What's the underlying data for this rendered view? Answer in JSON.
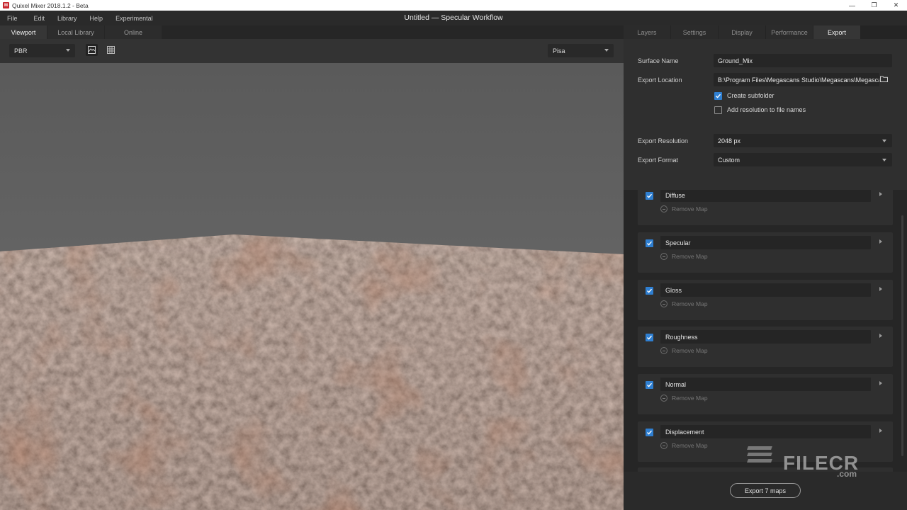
{
  "titlebar": {
    "title": "Quixel Mixer 2018.1.2 - Beta",
    "icon": "mixer-app-icon",
    "minimize": "—",
    "restore": "❐",
    "close": "✕"
  },
  "menu": {
    "items": [
      "File",
      "Edit",
      "Library",
      "Help",
      "Experimental"
    ],
    "window_title": "Untitled — Specular Workflow"
  },
  "left_tabs": [
    {
      "label": "Viewport",
      "active": true
    },
    {
      "label": "Local Library",
      "active": false
    },
    {
      "label": "Online",
      "active": false
    }
  ],
  "viewport_toolbar": {
    "render_mode": "PBR",
    "environment": "Pisa",
    "icons": [
      "image-icon",
      "grid-icon"
    ]
  },
  "right_tabs": [
    {
      "label": "Layers",
      "active": false
    },
    {
      "label": "Settings",
      "active": false
    },
    {
      "label": "Display",
      "active": false
    },
    {
      "label": "Performance",
      "active": false
    },
    {
      "label": "Export",
      "active": true
    }
  ],
  "export": {
    "surface_name_label": "Surface Name",
    "surface_name_value": "Ground_Mix",
    "export_location_label": "Export Location",
    "export_location_value": "B:\\Program Files\\Megascans Studio\\Megascans\\Megascans",
    "create_subfolder_label": "Create subfolder",
    "create_subfolder_checked": true,
    "add_resolution_label": "Add resolution to file names",
    "add_resolution_checked": false,
    "resolution_label": "Export Resolution",
    "resolution_value": "2048 px",
    "format_label": "Export Format",
    "format_value": "Custom"
  },
  "maps": [
    {
      "name": "Diffuse",
      "checked": true,
      "remove_label": "Remove Map"
    },
    {
      "name": "Specular",
      "checked": true,
      "remove_label": "Remove Map"
    },
    {
      "name": "Gloss",
      "checked": true,
      "remove_label": "Remove Map"
    },
    {
      "name": "Roughness",
      "checked": true,
      "remove_label": "Remove Map"
    },
    {
      "name": "Normal",
      "checked": true,
      "remove_label": "Remove Map"
    },
    {
      "name": "Displacement",
      "checked": true,
      "remove_label": "Remove Map"
    }
  ],
  "export_button": "Export 7 maps",
  "watermark": {
    "brand": "FILECR",
    "domain": ".com"
  },
  "colors": {
    "accent": "#2f7fd1",
    "panel": "#2e2e2e",
    "background": "#1f1f1f"
  }
}
